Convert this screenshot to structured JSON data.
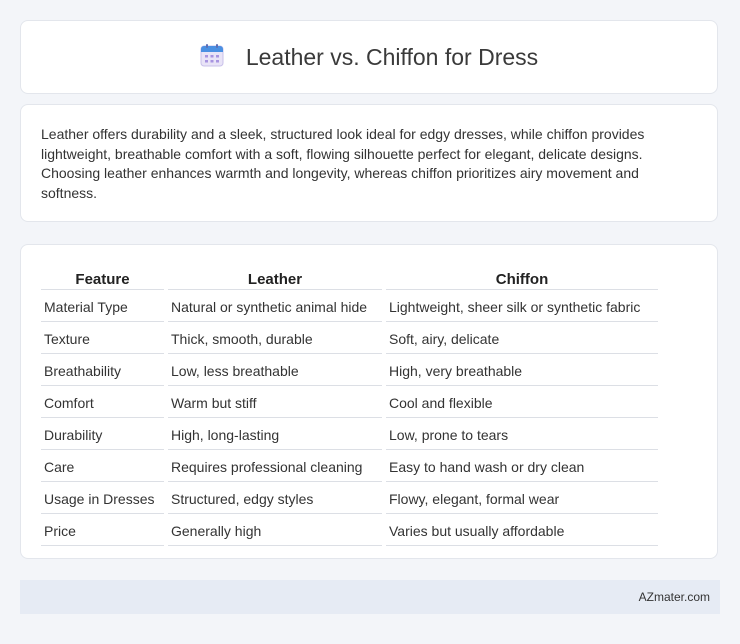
{
  "header": {
    "icon": "calendar-icon",
    "title": "Leather vs. Chiffon for Dress"
  },
  "summary": "Leather offers durability and a sleek, structured look ideal for edgy dresses, while chiffon provides lightweight, breathable comfort with a soft, flowing silhouette perfect for elegant, delicate designs. Choosing leather enhances warmth and longevity, whereas chiffon prioritizes airy movement and softness.",
  "table": {
    "headers": [
      "Feature",
      "Leather",
      "Chiffon"
    ],
    "rows": [
      [
        "Material Type",
        "Natural or synthetic animal hide",
        "Lightweight, sheer silk or synthetic fabric"
      ],
      [
        "Texture",
        "Thick, smooth, durable",
        "Soft, airy, delicate"
      ],
      [
        "Breathability",
        "Low, less breathable",
        "High, very breathable"
      ],
      [
        "Comfort",
        "Warm but stiff",
        "Cool and flexible"
      ],
      [
        "Durability",
        "High, long-lasting",
        "Low, prone to tears"
      ],
      [
        "Care",
        "Requires professional cleaning",
        "Easy to hand wash or dry clean"
      ],
      [
        "Usage in Dresses",
        "Structured, edgy styles",
        "Flowy, elegant, formal wear"
      ],
      [
        "Price",
        "Generally high",
        "Varies but usually affordable"
      ]
    ]
  },
  "footer": {
    "brand": "AZmater.com"
  }
}
